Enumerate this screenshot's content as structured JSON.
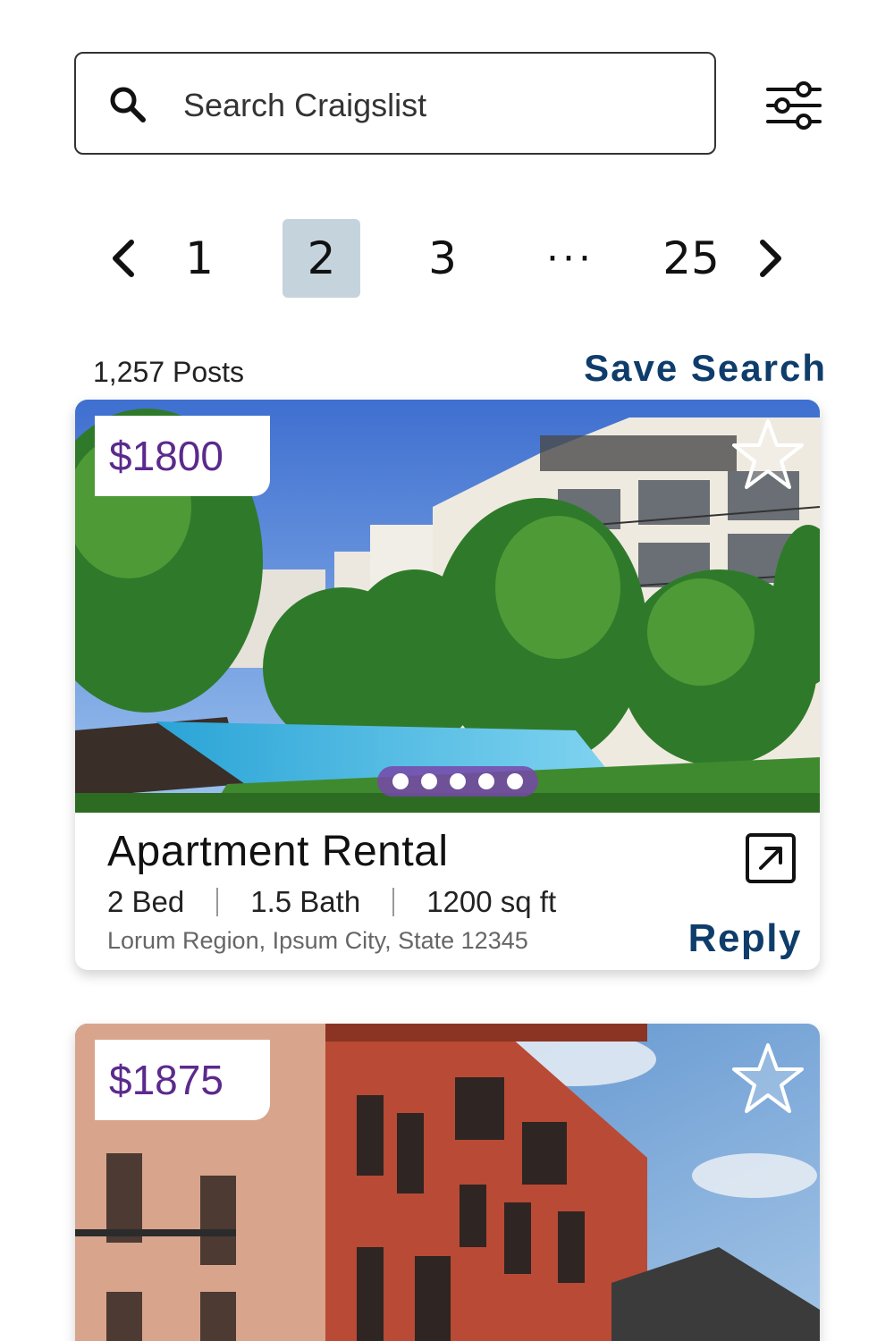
{
  "search": {
    "placeholder": "Search Craigslist"
  },
  "pagination": {
    "prev_glyph": "‹",
    "pages": [
      "1",
      "2",
      "3",
      "···",
      "25"
    ],
    "current": "2",
    "next_glyph": "›"
  },
  "results": {
    "count_text": "1,257 Posts",
    "save_search_label": "Save Search"
  },
  "listings": [
    {
      "price": "$1800",
      "title": "Apartment Rental",
      "beds": "2 Bed",
      "baths": "1.5 Bath",
      "area": "1200 sq ft",
      "address": "Lorum Region, Ipsum City, State 12345",
      "reply_label": "Reply",
      "photo_count": 5,
      "favorited": false
    },
    {
      "price": "$1875",
      "favorited": false
    }
  ],
  "colors": {
    "accent_navy": "#0f3d6b",
    "price_purple": "#5b2a8c",
    "active_page_bg": "#c5d3dc",
    "dots_bg": "#7846aa"
  },
  "icons": [
    "search-icon",
    "filter-sliders-icon",
    "chevron-left-icon",
    "chevron-right-icon",
    "star-icon",
    "external-link-icon"
  ]
}
